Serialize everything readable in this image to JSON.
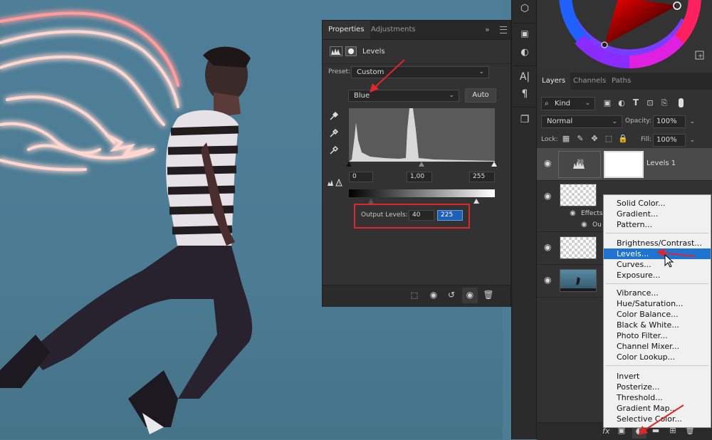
{
  "properties": {
    "tabs": [
      "Properties",
      "Adjustments"
    ],
    "panel_menu": "»",
    "adjustment_title": "Levels",
    "preset_label": "Preset:",
    "preset_value": "Custom",
    "channel_value": "Blue",
    "auto_label": "Auto",
    "input_levels": [
      "0",
      "1,00",
      "255"
    ],
    "output_label": "Output Levels:",
    "output_values": [
      "40",
      "225"
    ]
  },
  "layers_panel": {
    "tabs": [
      "Layers",
      "Channels",
      "Paths"
    ],
    "kind_label": "Kind",
    "blend_mode": "Normal",
    "opacity_label": "Opacity:",
    "opacity_value": "100%",
    "lock_label": "Lock:",
    "fill_label": "Fill:",
    "fill_value": "100%",
    "levels_layer_name": "Levels 1",
    "effects_label": "Effects",
    "outer_glow_label": "Ou",
    "fx_label": "fx"
  },
  "adjustment_menu": {
    "group1": [
      "Solid Color...",
      "Gradient...",
      "Pattern..."
    ],
    "group2": [
      "Brightness/Contrast...",
      "Levels...",
      "Curves...",
      "Exposure..."
    ],
    "group3": [
      "Vibrance...",
      "Hue/Saturation...",
      "Color Balance...",
      "Black & White...",
      "Photo Filter...",
      "Channel Mixer...",
      "Color Lookup..."
    ],
    "group4": [
      "Invert",
      "Posterize...",
      "Threshold...",
      "Gradient Map...",
      "Selective Color..."
    ],
    "highlighted": "Levels..."
  },
  "colors": {
    "annotation_red": "#e0262b",
    "menu_highlight": "#1f73d1",
    "panel_bg": "#323232"
  }
}
